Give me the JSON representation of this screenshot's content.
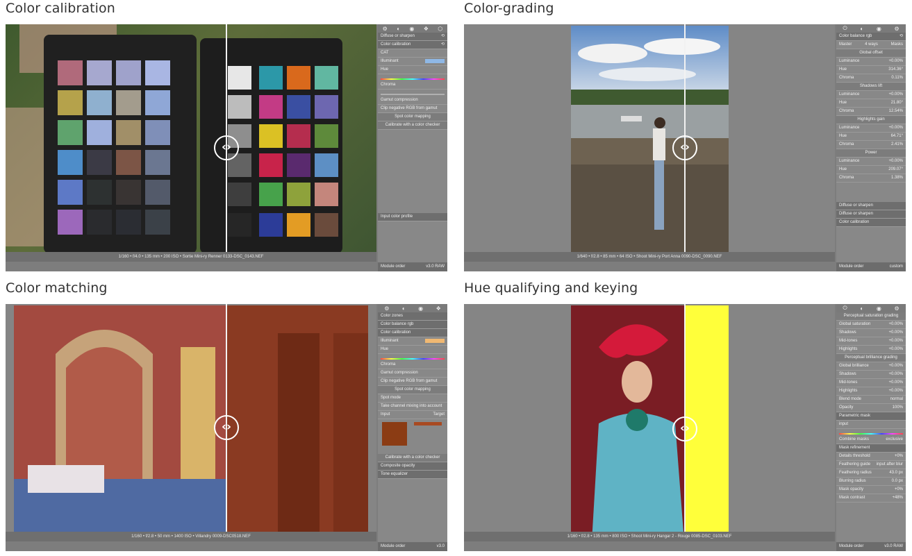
{
  "sections": [
    {
      "title": "Color calibration",
      "status": "1/160 • f/4.0 • 135 mm • 200 ISO • Sortie Mini-ry Renner 0133-DSC_0143.NEF",
      "bottom_left": "Module order",
      "bottom_right": "v3.0 RAW",
      "panel": [
        "Diffuse or sharpen",
        "Color calibration",
        "CAT",
        "Illuminant",
        "Hue",
        "Chroma",
        "Gamut compression",
        "Clip negative RGB from gamut",
        "Spot color mapping",
        "Calibrate with a color checker",
        "Input color profile"
      ]
    },
    {
      "title": "Color-grading",
      "status": "1/640 • f/2.8 • 85 mm • 64 ISO • Shoot Mini-ry Port Anna 0090-DSC_0090.NEF",
      "bottom_left": "Module order",
      "bottom_right": "custom",
      "panel": [
        "Color balance rgb",
        "Master",
        "4 ways",
        "Masks",
        "Global offset",
        "Luminance",
        "Hue",
        "Chroma",
        "Shadows lift",
        "Luminance",
        "Hue",
        "Chroma",
        "Highlights gain",
        "Luminance",
        "Hue",
        "Chroma",
        "Power",
        "Luminance",
        "Hue",
        "Chroma",
        "Diffuse or sharpen",
        "Diffuse or sharpen",
        "Color calibration"
      ],
      "values": [
        "+0.00%",
        "314.36°",
        "0.11%",
        "+0.00%",
        "21.80°",
        "12.54%",
        "+0.00%",
        "64.71°",
        "2.41%",
        "+0.00%",
        "209.07°",
        "1.38%"
      ]
    },
    {
      "title": "Color matching",
      "status": "1/160 • f/2.8 • 50 mm • 1400 ISO • Villandry 0009-DSC0518.NEF",
      "bottom_left": "Module order",
      "bottom_right": "v3.0",
      "panel": [
        "Color zones",
        "Color balance rgb",
        "Color calibration",
        "Illuminant",
        "Hue",
        "Chroma",
        "Gamut compression",
        "Clip negative RGB from gamut",
        "Spot color mapping",
        "Spot mode",
        "Take channel mixing into account",
        "Input",
        "Target",
        "Calibrate with a color checker",
        "Composite opacity",
        "Tone equalizer"
      ]
    },
    {
      "title": "Hue qualifying and keying",
      "status": "1/160 • f/2.8 • 135 mm • 800 ISO • Shoot Mini-ry Hangar 2 - Rouge 0085-DSC_0103.NEF",
      "bottom_left": "Module order",
      "bottom_right": "v3.0 RAW",
      "panel": [
        "Perceptual saturation grading",
        "Global saturation",
        "Shadows",
        "Mid-tones",
        "Highlights",
        "Perceptual brilliance grading",
        "Global brilliance",
        "Shadows",
        "Mid-tones",
        "Highlights",
        "Blend mode",
        "Opacity",
        "Parametric mask",
        "input",
        "Combine masks",
        "Mask refinement",
        "Details threshold",
        "Feathering guide",
        "Feathering radius",
        "Blurring radius",
        "Mask opacity",
        "Mask contrast"
      ],
      "values": [
        "+0.00%",
        "+0.00%",
        "+0.00%",
        "+0.00%",
        "+0.00%",
        "+0.00%",
        "+0.00%",
        "+0.00%",
        "normal",
        "100%",
        "exclusive",
        "+0%",
        "input after blur",
        "43.0 px",
        "0.0 px",
        "+0%",
        "+48%"
      ]
    }
  ],
  "colors": {
    "panel_bg": "#888888",
    "dark_bg": "#7d7d7d",
    "key_yellow": "#ffff3a"
  }
}
